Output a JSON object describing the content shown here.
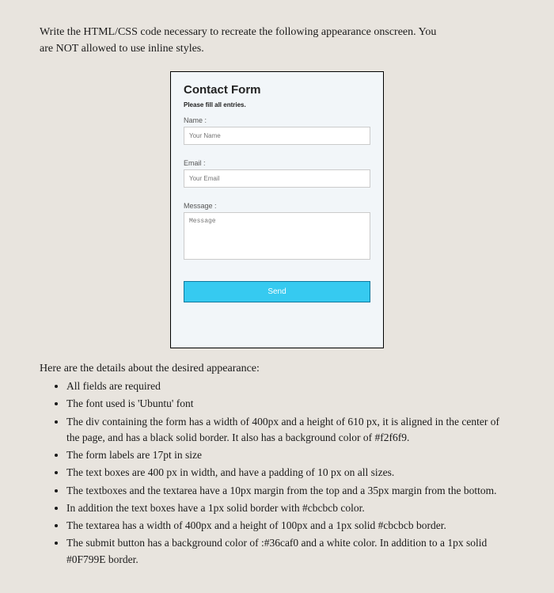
{
  "intro": {
    "line1": "Write the HTML/CSS code necessary to recreate the following appearance onscreen. You",
    "line2": "are NOT allowed to use inline styles."
  },
  "form": {
    "title": "Contact Form",
    "subtitle": "Please fill all entries.",
    "name_label": "Name :",
    "name_placeholder": "Your Name",
    "email_label": "Email :",
    "email_placeholder": "Your Email",
    "message_label": "Message :",
    "message_placeholder": "Message",
    "button_label": "Send"
  },
  "details": {
    "intro": "Here are the details about the desired appearance:",
    "items": [
      "All fields are required",
      "The font used is 'Ubuntu' font",
      "The div containing the form has a width of 400px and a height of 610 px, it is aligned in the center of the page, and has a black solid border. It also has a background color of #f2f6f9.",
      "The form labels are 17pt in size",
      "The text boxes are 400 px in width, and have a padding of 10 px on all sizes.",
      "The textboxes and the textarea have a 10px margin from the top and a 35px margin from the bottom.",
      "In addition the text boxes have a 1px solid border with #cbcbcb color.",
      "The textarea has a width of 400px and a height of 100px and a 1px solid #cbcbcb border.",
      "The submit button has a background color of :#36caf0 and a white color. In addition to a 1px solid #0F799E border."
    ]
  }
}
